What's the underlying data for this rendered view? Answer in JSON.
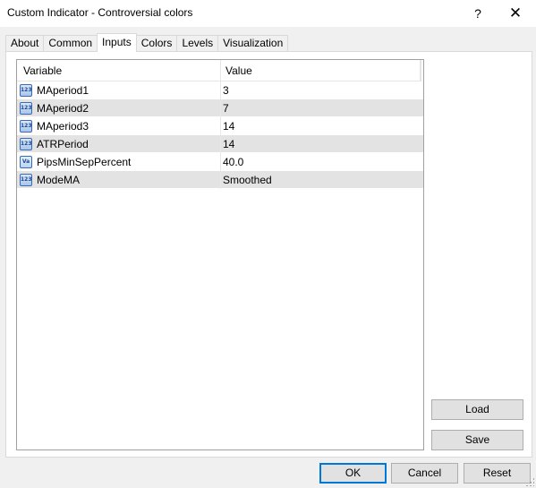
{
  "window": {
    "title": "Custom Indicator - Controversial colors",
    "help_label": "?",
    "close_label": "✕"
  },
  "tabs": [
    {
      "label": "About",
      "active": false
    },
    {
      "label": "Common",
      "active": false
    },
    {
      "label": "Inputs",
      "active": true
    },
    {
      "label": "Colors",
      "active": false
    },
    {
      "label": "Levels",
      "active": false
    },
    {
      "label": "Visualization",
      "active": false
    }
  ],
  "table": {
    "headers": {
      "variable": "Variable",
      "value": "Value"
    },
    "rows": [
      {
        "icon": "integer-type-icon",
        "icon_text": "123",
        "name": "MAperiod1",
        "value": "3"
      },
      {
        "icon": "integer-type-icon",
        "icon_text": "123",
        "name": "MAperiod2",
        "value": "7"
      },
      {
        "icon": "integer-type-icon",
        "icon_text": "123",
        "name": "MAperiod3",
        "value": "14"
      },
      {
        "icon": "integer-type-icon",
        "icon_text": "123",
        "name": "ATRPeriod",
        "value": "14"
      },
      {
        "icon": "double-type-icon",
        "icon_text": "Va",
        "name": "PipsMinSepPercent",
        "value": "40.0"
      },
      {
        "icon": "integer-type-icon",
        "icon_text": "123",
        "name": "ModeMA",
        "value": "Smoothed"
      }
    ]
  },
  "side_buttons": {
    "load": "Load",
    "save": "Save"
  },
  "footer": {
    "ok": "OK",
    "cancel": "Cancel",
    "reset": "Reset"
  },
  "colors": {
    "ok_focus_border": "#0078d7",
    "row_alt_bg": "#e3e3e3",
    "icon_blue": "#3b6ab5"
  }
}
